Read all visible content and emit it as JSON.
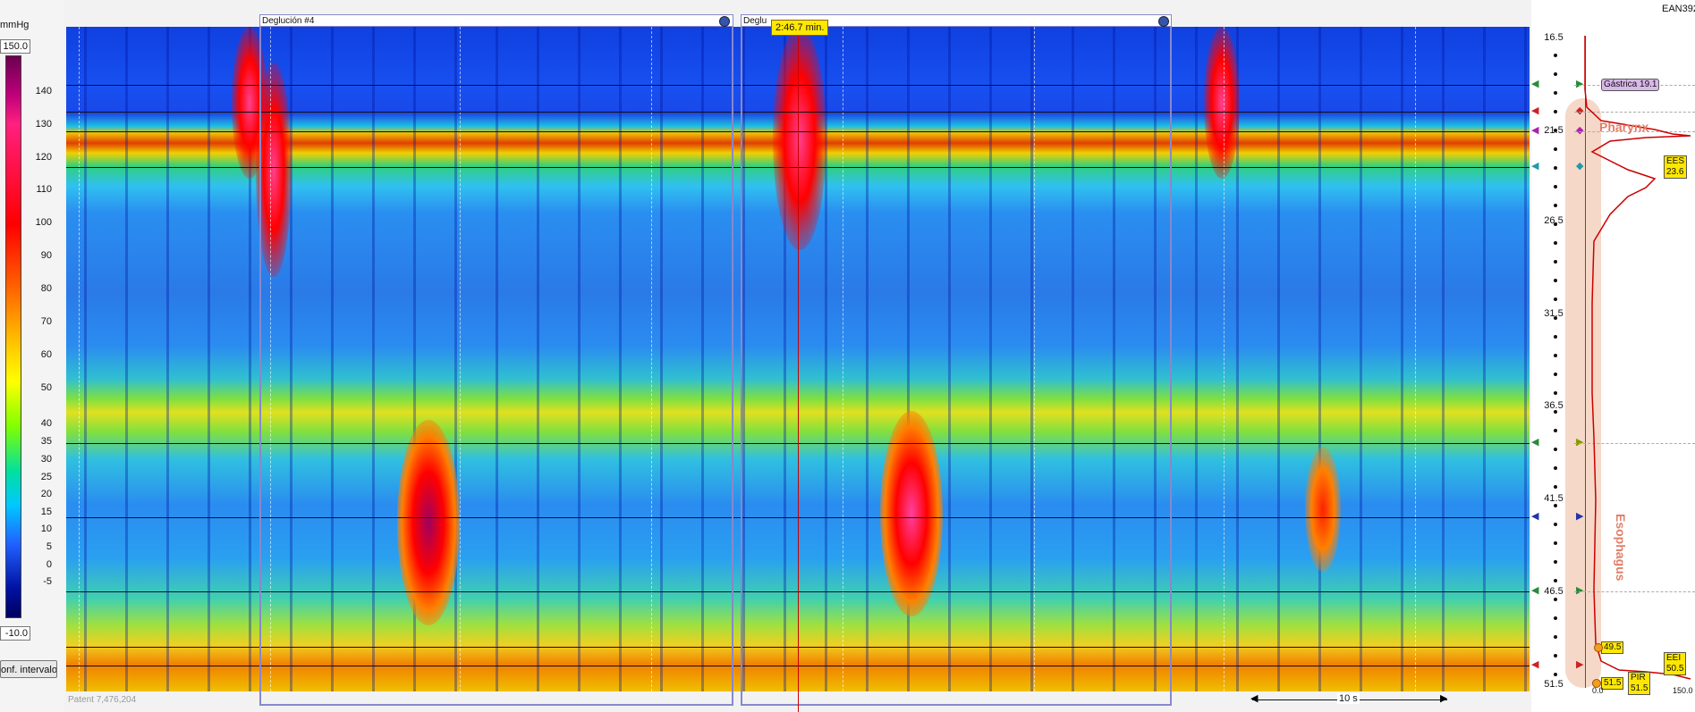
{
  "scale": {
    "unit": "mmHg",
    "max_box": "150.0",
    "min_box": "-10.0",
    "ticks": [
      "140",
      "130",
      "120",
      "110",
      "100",
      "90",
      "80",
      "70",
      "60",
      "50",
      "40",
      "35",
      "30",
      "25",
      "20",
      "15",
      "10",
      "5",
      "0",
      "-5"
    ],
    "conf_button": "onf. intervalo"
  },
  "swallows": [
    {
      "label": "Deglución #4"
    },
    {
      "label": "Deglu"
    }
  ],
  "cursor": {
    "time_label": "2:46.7 min."
  },
  "footer": {
    "patient": "Patent 7,476,204",
    "scale_label": "10 s"
  },
  "right": {
    "id_label": "EAN392",
    "depths": [
      "16.5",
      "21.5",
      "26.5",
      "31.5",
      "36.5",
      "41.5",
      "46.5",
      "51.5"
    ],
    "tags": {
      "gastrica": "Gástrica 19.1",
      "ees": "EES\n23.6",
      "eei": "EEI\n50.5",
      "pir": "PIR\n51.5",
      "m1": "49.5",
      "m2": "51.5"
    },
    "region_pharynx": "Pharynx",
    "region_esophagus": "Esophagus",
    "axis_min": "0.0",
    "axis_max": "150.0"
  },
  "colors": {
    "cursor": "#cc0000",
    "frame": "#8888cc",
    "badge": "#ffe800",
    "anatomy": "#f6d8c8",
    "profile": "#cc0000"
  }
}
